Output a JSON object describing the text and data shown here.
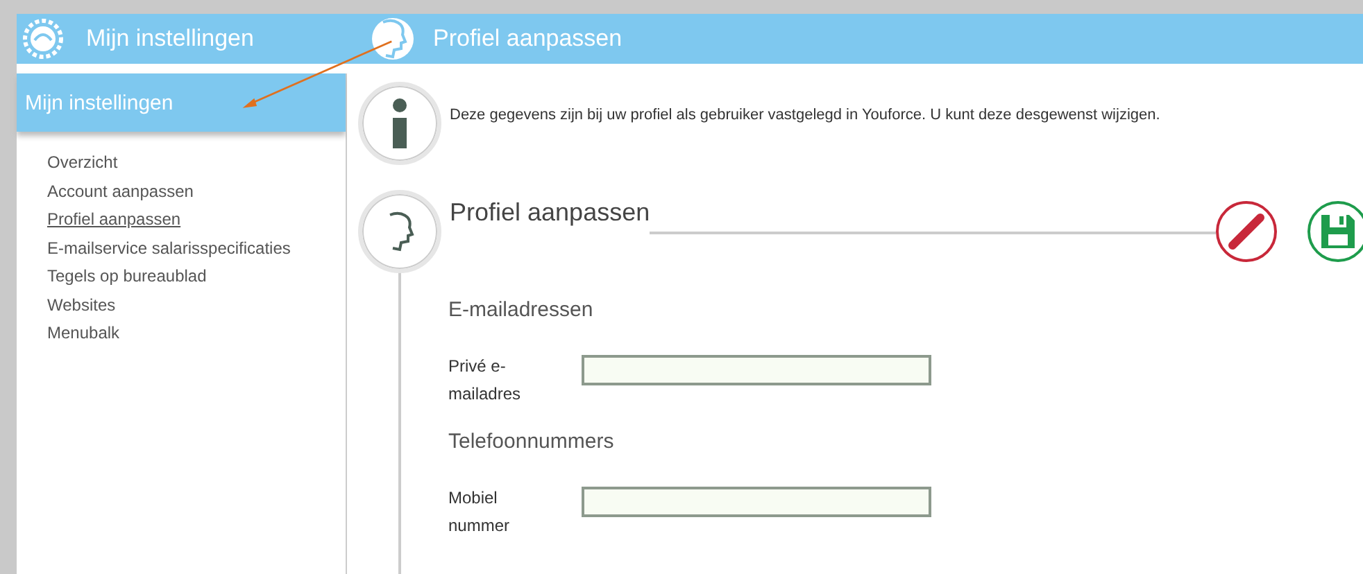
{
  "app_header": {
    "title": "Mijn instellingen",
    "page_title": "Profiel aanpassen"
  },
  "sidebar": {
    "title": "Mijn instellingen",
    "items": [
      {
        "label": "Overzicht",
        "selected": false
      },
      {
        "label": "Account aanpassen",
        "selected": false
      },
      {
        "label": "Profiel aanpassen",
        "selected": true
      },
      {
        "label": "E-mailservice salarisspecificaties",
        "selected": false
      },
      {
        "label": "Tegels op bureaublad",
        "selected": false
      },
      {
        "label": "Websites",
        "selected": false
      },
      {
        "label": "Menubalk",
        "selected": false
      }
    ]
  },
  "info": {
    "text": "Deze gegevens zijn bij uw profiel als gebruiker vastgelegd in Youforce. U kunt deze desgewenst wijzigen."
  },
  "section": {
    "title": "Profiel aanpassen",
    "actions": [
      {
        "kind": "cancel"
      },
      {
        "kind": "save"
      }
    ],
    "groups": [
      {
        "title": "E-mailadressen",
        "fields": [
          {
            "label": "Privé e-mailadres"
          }
        ]
      },
      {
        "title": "Telefoonnummers",
        "fields": [
          {
            "label": "Mobiel nummer"
          }
        ]
      }
    ]
  }
}
